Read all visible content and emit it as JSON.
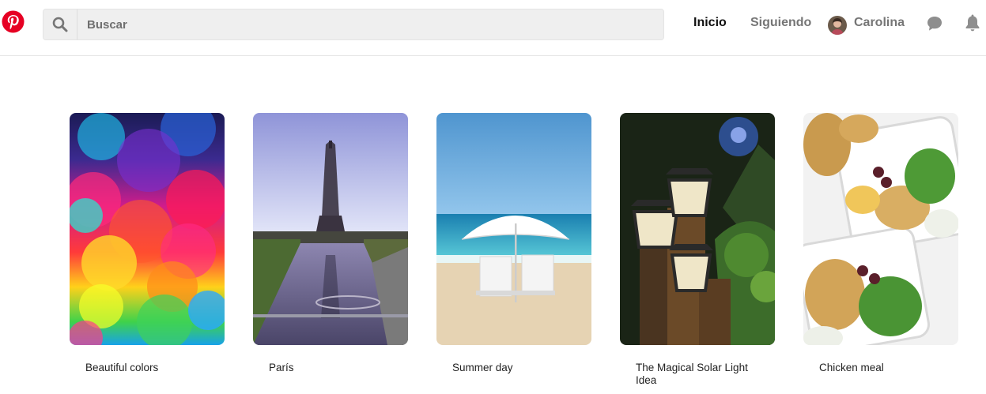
{
  "header": {
    "logo_icon": "pinterest-logo",
    "search": {
      "placeholder": "Buscar",
      "value": "",
      "icon": "search-icon"
    },
    "nav": {
      "home": "Inicio",
      "following": "Siguiendo",
      "profile": "Carolina"
    },
    "icons": {
      "messages": "chat-bubble-icon",
      "notifications": "bell-icon"
    },
    "colors": {
      "brand": "#e60023",
      "active_nav": "#111111",
      "inactive_nav": "#767676"
    }
  },
  "pins": [
    {
      "title": "Beautiful colors"
    },
    {
      "title": "París"
    },
    {
      "title": "Summer day"
    },
    {
      "title": "The Magical Solar Light Idea"
    },
    {
      "title": "Chicken meal"
    }
  ]
}
